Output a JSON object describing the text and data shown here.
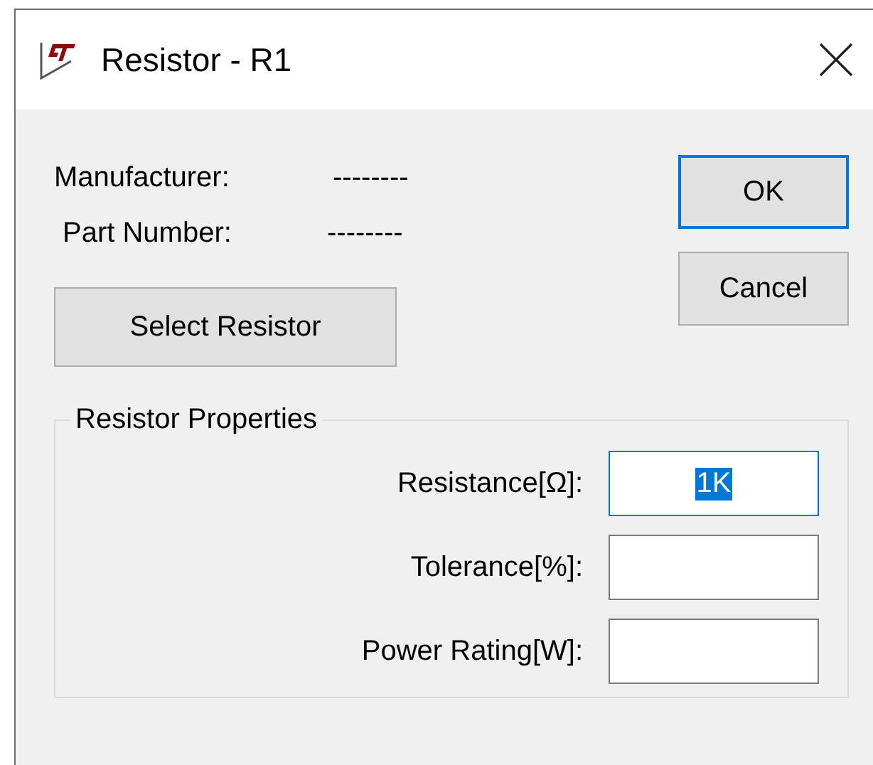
{
  "window": {
    "title": "Resistor - R1"
  },
  "info": [
    {
      "label": "Manufacturer:",
      "value": "--------"
    },
    {
      "label": "Part Number:",
      "value": "--------"
    }
  ],
  "select_button": {
    "label": "Select Resistor"
  },
  "buttons": [
    {
      "label": "OK",
      "focused": true
    },
    {
      "label": "Cancel",
      "focused": false
    }
  ],
  "group": {
    "title": "Resistor Properties",
    "fields": [
      {
        "label": "Resistance[Ω]:",
        "value": "1K",
        "focused": true
      },
      {
        "label": "Tolerance[%]:",
        "focused": false
      },
      {
        "label": "Power Rating[W]:",
        "focused": false
      }
    ]
  }
}
